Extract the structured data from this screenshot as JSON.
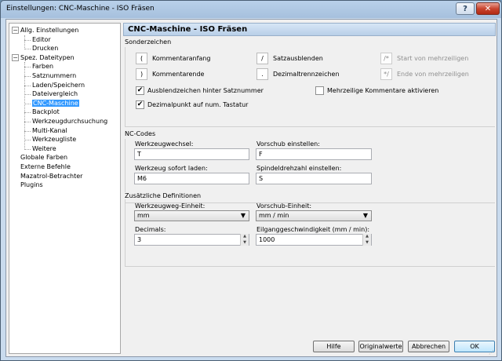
{
  "window": {
    "title": "Einstellungen: CNC-Maschine - ISO Fräsen",
    "help_glyph": "?",
    "close_glyph": "✕"
  },
  "tree": {
    "items": [
      {
        "label": "Allg. Einstellungen",
        "name": "tree-item-allg-einstellungen",
        "expander": "−"
      },
      {
        "label": "Editor",
        "name": "tree-item-editor"
      },
      {
        "label": "Drucken",
        "name": "tree-item-drucken"
      },
      {
        "label": "Spez. Dateitypen",
        "name": "tree-item-spez-dateitypen",
        "expander": "−"
      },
      {
        "label": "Farben",
        "name": "tree-item-farben"
      },
      {
        "label": "Satznummern",
        "name": "tree-item-satznummern"
      },
      {
        "label": "Laden/Speichern",
        "name": "tree-item-laden-speichern"
      },
      {
        "label": "Dateivergleich",
        "name": "tree-item-dateivergleich"
      },
      {
        "label": "CNC-Maschine",
        "name": "tree-item-cnc-maschine",
        "selected": true
      },
      {
        "label": "Backplot",
        "name": "tree-item-backplot"
      },
      {
        "label": "Werkzeugdurchsuchung",
        "name": "tree-item-werkzeugdurchsuchung"
      },
      {
        "label": "Multi-Kanal",
        "name": "tree-item-multi-kanal"
      },
      {
        "label": "Werkzeugliste",
        "name": "tree-item-werkzeugliste"
      },
      {
        "label": "Weitere",
        "name": "tree-item-weitere"
      },
      {
        "label": "Globale Farben",
        "name": "tree-item-globale-farben"
      },
      {
        "label": "Externe Befehle",
        "name": "tree-item-externe-befehle"
      },
      {
        "label": "Mazatrol-Betrachter",
        "name": "tree-item-mazatrol-betrachter"
      },
      {
        "label": "Plugins",
        "name": "tree-item-plugins"
      }
    ]
  },
  "panel": {
    "title": "CNC-Maschine - ISO Fräsen"
  },
  "sonderzeichen": {
    "title": "Sonderzeichen",
    "kommentaranfang": {
      "key": "(",
      "label": "Kommentaranfang"
    },
    "kommentarende": {
      "key": ")",
      "label": "Kommentarende"
    },
    "satzausblenden": {
      "key": "/",
      "label": "Satzausblenden"
    },
    "dezimaltrennzeichen": {
      "key": ".",
      "label": "Dezimaltrennzeichen"
    },
    "start_mehrzeilig": {
      "key": "/*",
      "label": "Start von mehrzeiligen"
    },
    "ende_mehrzeilig": {
      "key": "*/",
      "label": "Ende von mehrzeiligen"
    },
    "check_ausblend": {
      "label": "Ausblendzeichen hinter Satznummer",
      "checked": "✔"
    },
    "check_dezimal": {
      "label": "Dezimalpunkt auf num. Tastatur",
      "checked": "✔"
    },
    "check_mehrzeilig": {
      "label": "Mehrzeilige Kommentare aktivieren",
      "checked": ""
    }
  },
  "nc_codes": {
    "title": "NC-Codes",
    "werkzeugwechsel": {
      "label": "Werkzeugwechsel:",
      "value": "T"
    },
    "vorschub": {
      "label": "Vorschub einstellen:",
      "value": "F"
    },
    "werkzeug_sofort": {
      "label": "Werkzeug sofort laden:",
      "value": "M6"
    },
    "spindeldrehzahl": {
      "label": "Spindeldrehzahl einstellen:",
      "value": "S"
    }
  },
  "definitionen": {
    "title": "Zusätzliche Definitionen",
    "werkzeugweg_einheit": {
      "label": "Werkzeugweg-Einheit:",
      "value": "mm"
    },
    "vorschub_einheit": {
      "label": "Vorschub-Einheit:",
      "value": "mm / min"
    },
    "decimals": {
      "label": "Decimals:",
      "value": "3"
    },
    "eilgang": {
      "label": "Eilganggeschwindigkeit (mm / min):",
      "value": "1000"
    }
  },
  "buttons": {
    "hilfe": "Hilfe",
    "originalwerte": "Originalwerte",
    "abbrechen": "Abbrechen",
    "ok": "OK"
  }
}
